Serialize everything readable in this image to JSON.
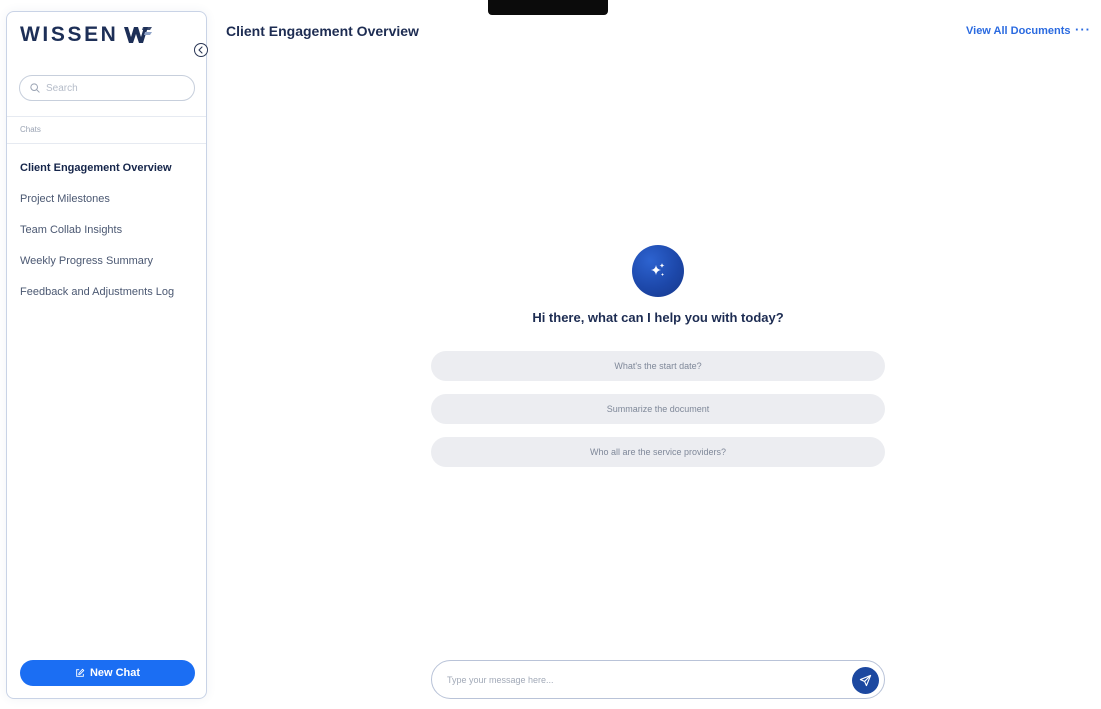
{
  "brand": {
    "name": "WISSEN"
  },
  "sidebar": {
    "search_placeholder": "Search",
    "section_label": "Chats",
    "chats": [
      {
        "label": "Client Engagement Overview",
        "active": true
      },
      {
        "label": "Project Milestones",
        "active": false
      },
      {
        "label": "Team Collab Insights",
        "active": false
      },
      {
        "label": "Weekly Progress Summary",
        "active": false
      },
      {
        "label": "Feedback and Adjustments Log",
        "active": false
      }
    ],
    "new_chat_label": "New Chat"
  },
  "header": {
    "title": "Client Engagement Overview",
    "view_all_label": "View All Documents",
    "more_label": "···"
  },
  "main": {
    "greeting": "Hi there, what can I help you with today?",
    "suggestions": [
      "What's the start date?",
      "Summarize the document",
      "Who all are the service providers?"
    ]
  },
  "composer": {
    "placeholder": "Type your message here..."
  },
  "colors": {
    "accent": "#1b6ef3",
    "brand_navy": "#1d2f57",
    "send_button": "#1c48a0"
  },
  "icons": {
    "collapse": "chevron-left-icon",
    "search": "search-icon",
    "new_chat": "edit-icon",
    "hero": "sparkles-icon",
    "send": "send-icon"
  }
}
